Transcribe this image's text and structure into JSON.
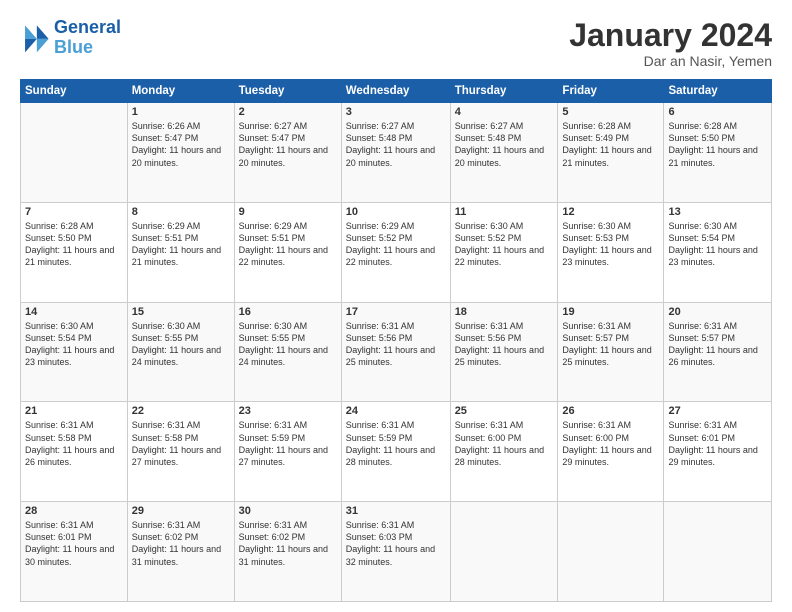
{
  "logo": {
    "line1": "General",
    "line2": "Blue"
  },
  "title": "January 2024",
  "subtitle": "Dar an Nasir, Yemen",
  "days_header": [
    "Sunday",
    "Monday",
    "Tuesday",
    "Wednesday",
    "Thursday",
    "Friday",
    "Saturday"
  ],
  "weeks": [
    [
      {
        "num": "",
        "sunrise": "",
        "sunset": "",
        "daylight": ""
      },
      {
        "num": "1",
        "sunrise": "Sunrise: 6:26 AM",
        "sunset": "Sunset: 5:47 PM",
        "daylight": "Daylight: 11 hours and 20 minutes."
      },
      {
        "num": "2",
        "sunrise": "Sunrise: 6:27 AM",
        "sunset": "Sunset: 5:47 PM",
        "daylight": "Daylight: 11 hours and 20 minutes."
      },
      {
        "num": "3",
        "sunrise": "Sunrise: 6:27 AM",
        "sunset": "Sunset: 5:48 PM",
        "daylight": "Daylight: 11 hours and 20 minutes."
      },
      {
        "num": "4",
        "sunrise": "Sunrise: 6:27 AM",
        "sunset": "Sunset: 5:48 PM",
        "daylight": "Daylight: 11 hours and 20 minutes."
      },
      {
        "num": "5",
        "sunrise": "Sunrise: 6:28 AM",
        "sunset": "Sunset: 5:49 PM",
        "daylight": "Daylight: 11 hours and 21 minutes."
      },
      {
        "num": "6",
        "sunrise": "Sunrise: 6:28 AM",
        "sunset": "Sunset: 5:50 PM",
        "daylight": "Daylight: 11 hours and 21 minutes."
      }
    ],
    [
      {
        "num": "7",
        "sunrise": "Sunrise: 6:28 AM",
        "sunset": "Sunset: 5:50 PM",
        "daylight": "Daylight: 11 hours and 21 minutes."
      },
      {
        "num": "8",
        "sunrise": "Sunrise: 6:29 AM",
        "sunset": "Sunset: 5:51 PM",
        "daylight": "Daylight: 11 hours and 21 minutes."
      },
      {
        "num": "9",
        "sunrise": "Sunrise: 6:29 AM",
        "sunset": "Sunset: 5:51 PM",
        "daylight": "Daylight: 11 hours and 22 minutes."
      },
      {
        "num": "10",
        "sunrise": "Sunrise: 6:29 AM",
        "sunset": "Sunset: 5:52 PM",
        "daylight": "Daylight: 11 hours and 22 minutes."
      },
      {
        "num": "11",
        "sunrise": "Sunrise: 6:30 AM",
        "sunset": "Sunset: 5:52 PM",
        "daylight": "Daylight: 11 hours and 22 minutes."
      },
      {
        "num": "12",
        "sunrise": "Sunrise: 6:30 AM",
        "sunset": "Sunset: 5:53 PM",
        "daylight": "Daylight: 11 hours and 23 minutes."
      },
      {
        "num": "13",
        "sunrise": "Sunrise: 6:30 AM",
        "sunset": "Sunset: 5:54 PM",
        "daylight": "Daylight: 11 hours and 23 minutes."
      }
    ],
    [
      {
        "num": "14",
        "sunrise": "Sunrise: 6:30 AM",
        "sunset": "Sunset: 5:54 PM",
        "daylight": "Daylight: 11 hours and 23 minutes."
      },
      {
        "num": "15",
        "sunrise": "Sunrise: 6:30 AM",
        "sunset": "Sunset: 5:55 PM",
        "daylight": "Daylight: 11 hours and 24 minutes."
      },
      {
        "num": "16",
        "sunrise": "Sunrise: 6:30 AM",
        "sunset": "Sunset: 5:55 PM",
        "daylight": "Daylight: 11 hours and 24 minutes."
      },
      {
        "num": "17",
        "sunrise": "Sunrise: 6:31 AM",
        "sunset": "Sunset: 5:56 PM",
        "daylight": "Daylight: 11 hours and 25 minutes."
      },
      {
        "num": "18",
        "sunrise": "Sunrise: 6:31 AM",
        "sunset": "Sunset: 5:56 PM",
        "daylight": "Daylight: 11 hours and 25 minutes."
      },
      {
        "num": "19",
        "sunrise": "Sunrise: 6:31 AM",
        "sunset": "Sunset: 5:57 PM",
        "daylight": "Daylight: 11 hours and 25 minutes."
      },
      {
        "num": "20",
        "sunrise": "Sunrise: 6:31 AM",
        "sunset": "Sunset: 5:57 PM",
        "daylight": "Daylight: 11 hours and 26 minutes."
      }
    ],
    [
      {
        "num": "21",
        "sunrise": "Sunrise: 6:31 AM",
        "sunset": "Sunset: 5:58 PM",
        "daylight": "Daylight: 11 hours and 26 minutes."
      },
      {
        "num": "22",
        "sunrise": "Sunrise: 6:31 AM",
        "sunset": "Sunset: 5:58 PM",
        "daylight": "Daylight: 11 hours and 27 minutes."
      },
      {
        "num": "23",
        "sunrise": "Sunrise: 6:31 AM",
        "sunset": "Sunset: 5:59 PM",
        "daylight": "Daylight: 11 hours and 27 minutes."
      },
      {
        "num": "24",
        "sunrise": "Sunrise: 6:31 AM",
        "sunset": "Sunset: 5:59 PM",
        "daylight": "Daylight: 11 hours and 28 minutes."
      },
      {
        "num": "25",
        "sunrise": "Sunrise: 6:31 AM",
        "sunset": "Sunset: 6:00 PM",
        "daylight": "Daylight: 11 hours and 28 minutes."
      },
      {
        "num": "26",
        "sunrise": "Sunrise: 6:31 AM",
        "sunset": "Sunset: 6:00 PM",
        "daylight": "Daylight: 11 hours and 29 minutes."
      },
      {
        "num": "27",
        "sunrise": "Sunrise: 6:31 AM",
        "sunset": "Sunset: 6:01 PM",
        "daylight": "Daylight: 11 hours and 29 minutes."
      }
    ],
    [
      {
        "num": "28",
        "sunrise": "Sunrise: 6:31 AM",
        "sunset": "Sunset: 6:01 PM",
        "daylight": "Daylight: 11 hours and 30 minutes."
      },
      {
        "num": "29",
        "sunrise": "Sunrise: 6:31 AM",
        "sunset": "Sunset: 6:02 PM",
        "daylight": "Daylight: 11 hours and 31 minutes."
      },
      {
        "num": "30",
        "sunrise": "Sunrise: 6:31 AM",
        "sunset": "Sunset: 6:02 PM",
        "daylight": "Daylight: 11 hours and 31 minutes."
      },
      {
        "num": "31",
        "sunrise": "Sunrise: 6:31 AM",
        "sunset": "Sunset: 6:03 PM",
        "daylight": "Daylight: 11 hours and 32 minutes."
      },
      {
        "num": "",
        "sunrise": "",
        "sunset": "",
        "daylight": ""
      },
      {
        "num": "",
        "sunrise": "",
        "sunset": "",
        "daylight": ""
      },
      {
        "num": "",
        "sunrise": "",
        "sunset": "",
        "daylight": ""
      }
    ]
  ]
}
